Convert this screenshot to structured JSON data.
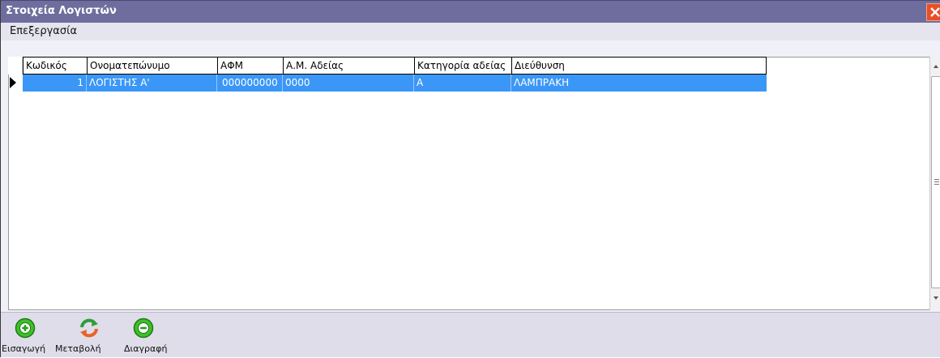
{
  "window": {
    "title": "Στοιχεία Λογιστών"
  },
  "menu": {
    "items": [
      "Επεξεργασία"
    ]
  },
  "grid": {
    "columns": [
      "Κωδικός",
      "Ονοματεπώνυμο",
      "ΑΦΜ",
      "Α.Μ. Αδείας",
      "Κατηγορία αδείας",
      "Διεύθυνση"
    ],
    "rows": [
      {
        "code": "1",
        "name": "ΛΟΓΙΣΤΗΣ Α'",
        "afm": "000000000",
        "am": "0000",
        "category": "Α",
        "address": "ΛΑΜΠΡΑΚΗ"
      }
    ]
  },
  "toolbar": {
    "insert_label": "Εισαγωγή",
    "edit_label": "Μεταβολή",
    "delete_label": "Διαγραφή"
  },
  "colors": {
    "titlebar": "#6f6d9e",
    "selected_row": "#3b97f7",
    "close": "#e8502a"
  },
  "icons": {
    "close": "close-icon",
    "insert": "plus-circle-icon",
    "edit": "refresh-arrows-icon",
    "delete": "minus-circle-icon"
  }
}
